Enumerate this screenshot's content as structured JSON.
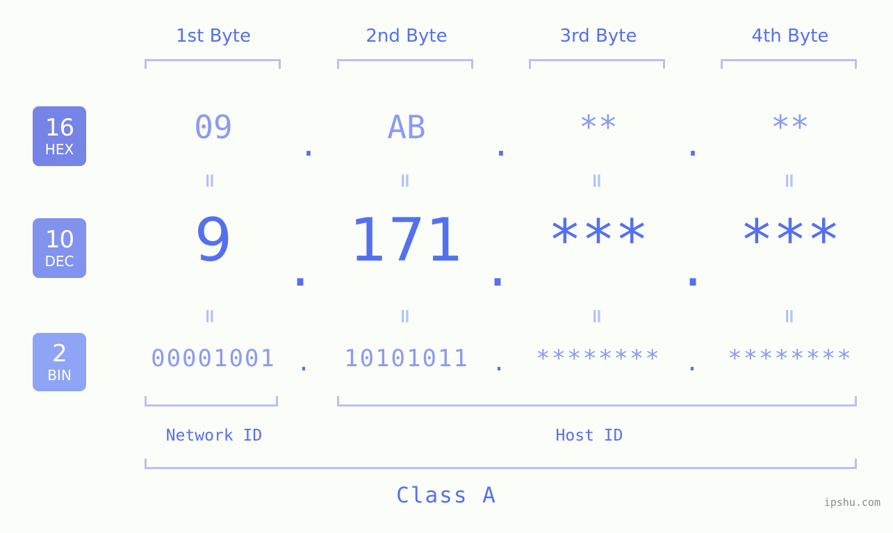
{
  "background_color": "#fbfdf8",
  "accent_color": "#5570ef",
  "accent_light_color": "#8c9af0",
  "bracket_color": "#b6c1f7",
  "header": {
    "bytes": [
      {
        "label": "1st Byte"
      },
      {
        "label": "2nd Byte"
      },
      {
        "label": "3rd Byte"
      },
      {
        "label": "4th Byte"
      }
    ]
  },
  "bases": [
    {
      "number": "16",
      "abbr": "HEX",
      "color": "#7684e8"
    },
    {
      "number": "10",
      "abbr": "DEC",
      "color": "#8193ef"
    },
    {
      "number": "2",
      "abbr": "BIN",
      "color": "#8fa4f5"
    }
  ],
  "rows": {
    "hex": {
      "values": [
        "09",
        "AB",
        "**",
        "**"
      ],
      "separators": [
        ".",
        ".",
        "."
      ]
    },
    "dec": {
      "values": [
        "9",
        "171",
        "***",
        "***"
      ],
      "separators": [
        ".",
        ".",
        "."
      ]
    },
    "bin": {
      "values": [
        "00001001",
        "10101011",
        "********",
        "********"
      ],
      "separators": [
        ".",
        ".",
        "."
      ]
    }
  },
  "equals_signs": {
    "hex_to_dec": [
      "=",
      "=",
      "=",
      "="
    ],
    "dec_to_bin": [
      "=",
      "=",
      "=",
      "="
    ]
  },
  "footer": {
    "network_id_label": "Network ID",
    "host_id_label": "Host ID",
    "class_label": "Class A",
    "watermark": "ipshu.com"
  }
}
